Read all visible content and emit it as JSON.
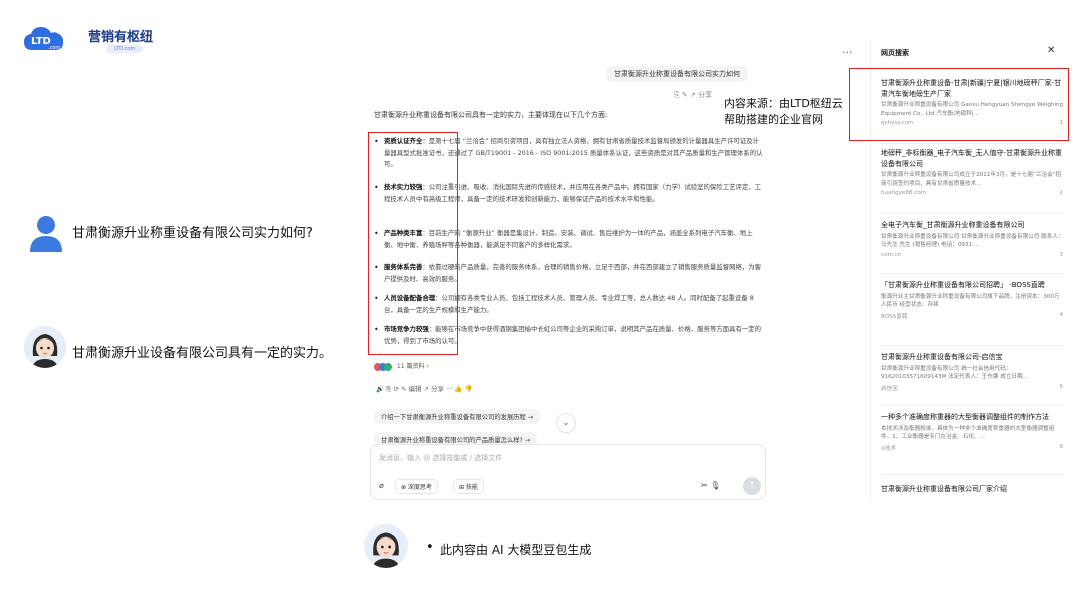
{
  "logo": {
    "brand": "营销有枢纽",
    "badge": "LTD.com",
    "cloud_text": "LTD",
    "cloud_sub": ".com"
  },
  "left": {
    "question": "甘肃衡源升业称重设备有限公司实力如何?",
    "answer": "甘肃衡源升业设备有限公司具有一定的实力。"
  },
  "chat": {
    "user_message": "甘肃衡源升业称重设备有限公司实力如何",
    "bubble_tools": "⎘  ✎  ↗ 分享",
    "intro": "甘肃衡源升业称重设备有限公司具有一定的实力，主要体现在以下几个方面:",
    "bullets": [
      {
        "title": "资质认证齐全",
        "text": "：是第十七届 “兰洽会” 招商引资项目，具有独立法人资格，拥有甘肃省质量技术监督局颁发的计量器具生产许可证及计量器具型式批准证书，还通过了 GB/T19001 - 2016 - ISO 9001:2015 质量体系认证，这些资质是对其产品质量和生产管理体系的认可。"
      },
      {
        "title": "技术实力较强",
        "text": "：公司注重引进、吸收、消化国际先进的传感技术，并应用在各类产品中。拥有国家（力学）试验室的保险工艺评定，工程技术人员中有高级工程师，具备一定的技术研发和创新能力，能够保证产品的技术水平和性能。"
      },
      {
        "title": "产品种类丰富",
        "text": "：目前生产的 “衡源升业” 衡器是集设计、制造、安装、调试、售后维护为一体的产品，涵盖全系列电子汽车衡、地上衡、地中衡、养殖场秤等各种衡器，能满足不同客户的多样化需求。"
      },
      {
        "title": "服务体系完善",
        "text": "：依靠过硬的产品质量，完善的服务体系，合理的销售价格，立足于西部，并在西部建立了销售服务质量监督网络，为客户提供及时、高效的服务。"
      },
      {
        "title": "人员设备配备合理",
        "text": "：公司拥有各类专业人员，包括工程技术人员、管理人员、专业焊工等，总人数达 48 人。同时配备了起重设备 8 台，具备一定的生产规模和生产能力。"
      },
      {
        "title": "市场竞争力较强",
        "text": "：能够在市场竞争中获得酒钢集团榆中长虹公司等企业的采购订单，说明其产品在质量、价格、服务等方面具有一定的优势，得到了市场的认可。"
      }
    ],
    "refs": "11 篇资料 ›",
    "reply_tools": "🔊  ⎘  ⟳  ✎ 编辑  ↗ 分享  ···  👍  👎",
    "suggestions": [
      "介绍一下甘肃衡源升业称重设备有限公司的发展历程 →",
      "甘肃衡源升业称重设备有限公司的产品质量怎么样? →"
    ],
    "down_arrow": "⌄",
    "input_placeholder": "发消息、输入 @ 选择技能或 / 选择文件",
    "chip_deep": "⊗ 深度思考",
    "chip_skill": "⊞ 技能",
    "attach_icon": "⌀",
    "right_tools": "✂   🎙",
    "send_icon": "↑",
    "more": "···"
  },
  "annotation": "内容来源：由LTD枢纽云帮助搭建的企业官网",
  "panel": {
    "title": "网页搜索",
    "close": "✕",
    "results": [
      {
        "title": "甘肃衡源升业称重设备-甘肃|新疆|宁夏|银川地磅秤厂家-甘肃汽车衡地磅生产厂家",
        "desc": "甘肃衡源升业称重设备有限公司 Gansu Hengyuan Shengye Weighing Equipment Co., Ltd 汽车衡|地磅秤|...",
        "src": "gshysy.com",
        "n": "1"
      },
      {
        "title": "地磅秤_非标衡器_电子汽车衡_无人值守-甘肃衡源升业称重设备有限公司",
        "desc": "甘肃衡源升业称重设备有限公司成立于2011年3月，是十七届“兰洽会”招商引资签约项目，具有甘肃省质量技术...",
        "src": "huangye88.com",
        "n": "2"
      },
      {
        "title": "全电子汽车衡_甘肃衡源升业称重设备有限公司",
        "desc": "甘肃衡源升业称重设备有限公司 甘肃衡源升业称重设备有限公司 联系人：马先生 先生 (销售经理) 电话：0931-...",
        "src": "com.cn",
        "n": "3"
      },
      {
        "title": "「甘肃衡源升业称重设备有限公司招聘」 -BOSS直聘",
        "desc": "衡源升业主甘肃衡源升业称重设备有限公司旗下品牌，注册资本：300万人民币 经营状态：存续",
        "src": "BOSS直聘",
        "n": "4"
      },
      {
        "title": "甘肃衡源升业称重设备有限公司-启信宝",
        "desc": "甘肃衡源升业称重设备有限公司 统一社会信用代码：91620103571609143M 法定代表人：王东廉 成立日期...",
        "src": "启信宝",
        "n": "5"
      },
      {
        "title": "一种多个准确度称重器的大型衡器调整组件的制作方法",
        "desc": "本技术涉及衡器校准，具体为一种多个准确度称重器的大型衡器调整组件。1、工业衡器是专门在冶金、石化、...",
        "src": "X技术",
        "n": "6"
      },
      {
        "title": "甘肃衡源升业称重设备有限公司厂家介绍",
        "desc": "",
        "src": "",
        "n": ""
      }
    ]
  },
  "footer": {
    "bullet": "•",
    "text": "此内容由 AI 大模型豆包生成"
  }
}
